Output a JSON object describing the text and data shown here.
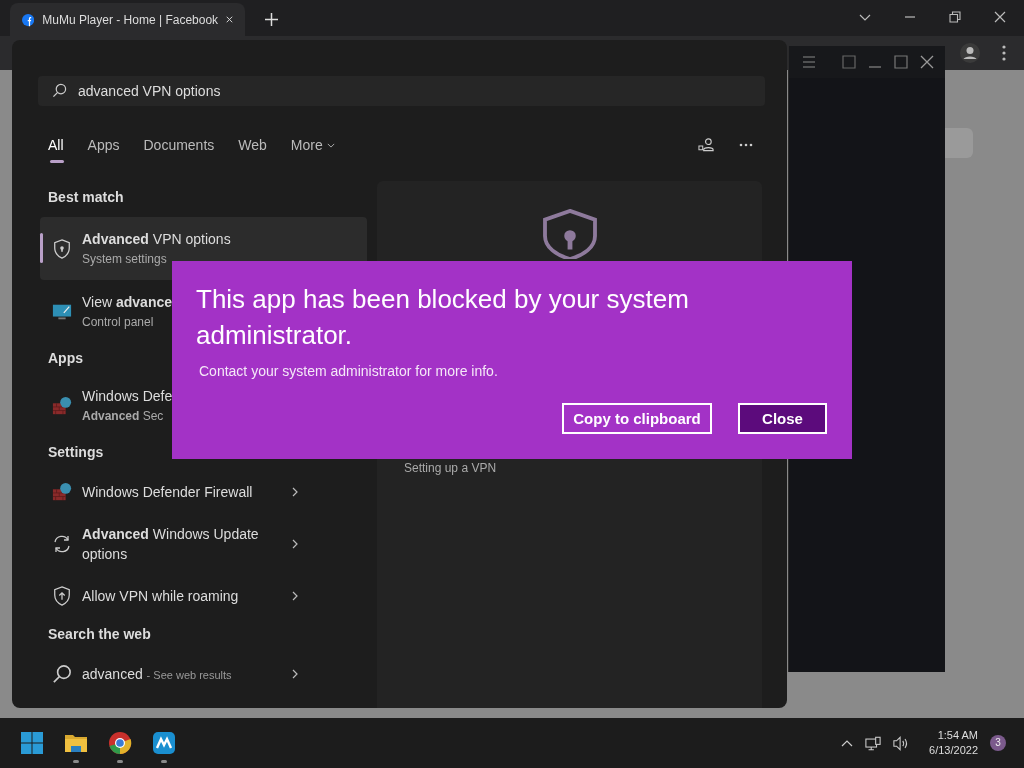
{
  "browser": {
    "tab_title": "MuMu Player - Home | Facebook"
  },
  "search": {
    "query": "advanced VPN options",
    "tabs": [
      {
        "label": "All",
        "selected": true,
        "dropdown": false
      },
      {
        "label": "Apps",
        "selected": false,
        "dropdown": false
      },
      {
        "label": "Documents",
        "selected": false,
        "dropdown": false
      },
      {
        "label": "Web",
        "selected": false,
        "dropdown": false
      },
      {
        "label": "More",
        "selected": false,
        "dropdown": true
      }
    ],
    "sections": [
      {
        "heading": "Best match",
        "items": [
          {
            "kind": "shield",
            "title": "**Advanced** VPN options",
            "subtitle": "System settings",
            "selected": true,
            "arrow": false
          },
          {
            "kind": "monitor",
            "title": "View **advance**",
            "subtitle": "Control panel",
            "selected": false,
            "arrow": false
          }
        ]
      },
      {
        "heading": "Apps",
        "items": [
          {
            "kind": "firewall",
            "title": "Windows Defe",
            "subtitle": "**Advanced** Sec",
            "selected": false,
            "arrow": false
          }
        ]
      },
      {
        "heading": "Settings",
        "items": [
          {
            "kind": "firewall",
            "title": "Windows Defender Firewall",
            "selected": false,
            "arrow": true
          },
          {
            "kind": "sync",
            "title": "**Advanced** Windows Update options",
            "selected": false,
            "arrow": true
          },
          {
            "kind": "shield-up",
            "title": "Allow VPN while roaming",
            "selected": false,
            "arrow": true
          }
        ]
      },
      {
        "heading": "Search the web",
        "items": [
          {
            "kind": "web",
            "title": "advanced",
            "hint": "- See web results",
            "selected": false,
            "arrow": true
          }
        ]
      }
    ],
    "preview": {
      "link": "Setting up a VPN"
    }
  },
  "dialog": {
    "title": "This app has been blocked by your system administrator.",
    "message": "Contact your system administrator for more info.",
    "buttons": [
      {
        "label": "Copy to clipboard",
        "kind": "secondary"
      },
      {
        "label": "Close",
        "kind": "primary"
      }
    ]
  },
  "taskbar": {
    "apps": [
      {
        "kind": "start",
        "running": false
      },
      {
        "kind": "folder",
        "running": true
      },
      {
        "kind": "browser",
        "running": true
      },
      {
        "kind": "player",
        "running": true
      }
    ],
    "time": "1:54 AM",
    "date": "6/13/2022",
    "notifications": "3"
  }
}
